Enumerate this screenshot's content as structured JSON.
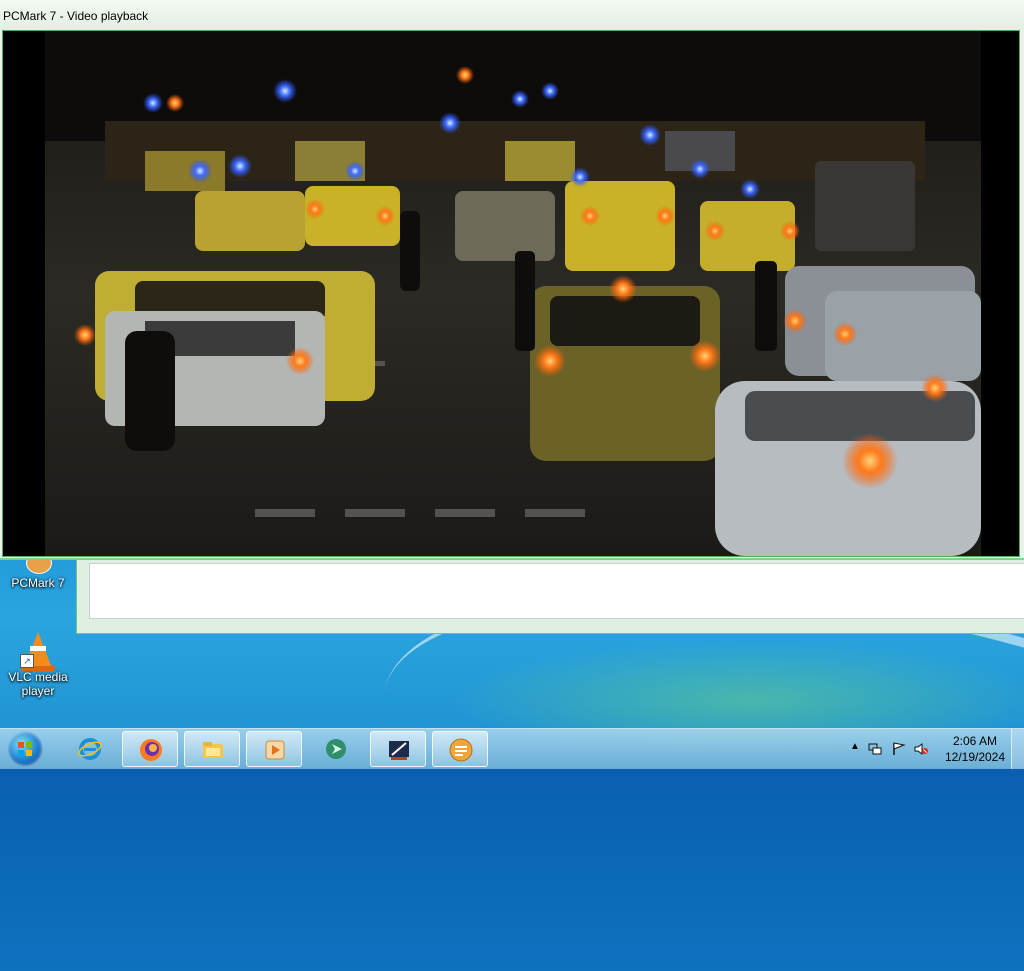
{
  "window": {
    "title": "PCMark 7 - Video playback"
  },
  "desktop": {
    "icons": [
      {
        "label": "PCMark 7",
        "icon": "pcmark-icon"
      },
      {
        "label": "VLC media player",
        "icon": "vlc-cone-icon"
      }
    ]
  },
  "taskbar": {
    "start": "windows-start-icon",
    "apps": [
      {
        "icon": "internet-explorer-icon"
      },
      {
        "icon": "firefox-icon"
      },
      {
        "icon": "file-explorer-icon"
      },
      {
        "icon": "media-player-icon"
      },
      {
        "icon": "edge-like-arrow-icon"
      },
      {
        "icon": "graphics-icon"
      },
      {
        "icon": "pcmark-icon"
      }
    ],
    "tray": {
      "icons": [
        "show-hidden-icons-chevron",
        "network-icon",
        "action-center-flag-icon",
        "speaker-muted-icon"
      ],
      "time": "2:06 AM",
      "date": "12/19/2024"
    }
  },
  "colors": {
    "desktop": "#1286d0",
    "window_chrome": "#e9f3ea",
    "window_border": "#55a864",
    "taxi_yellow": "#c9b227"
  }
}
